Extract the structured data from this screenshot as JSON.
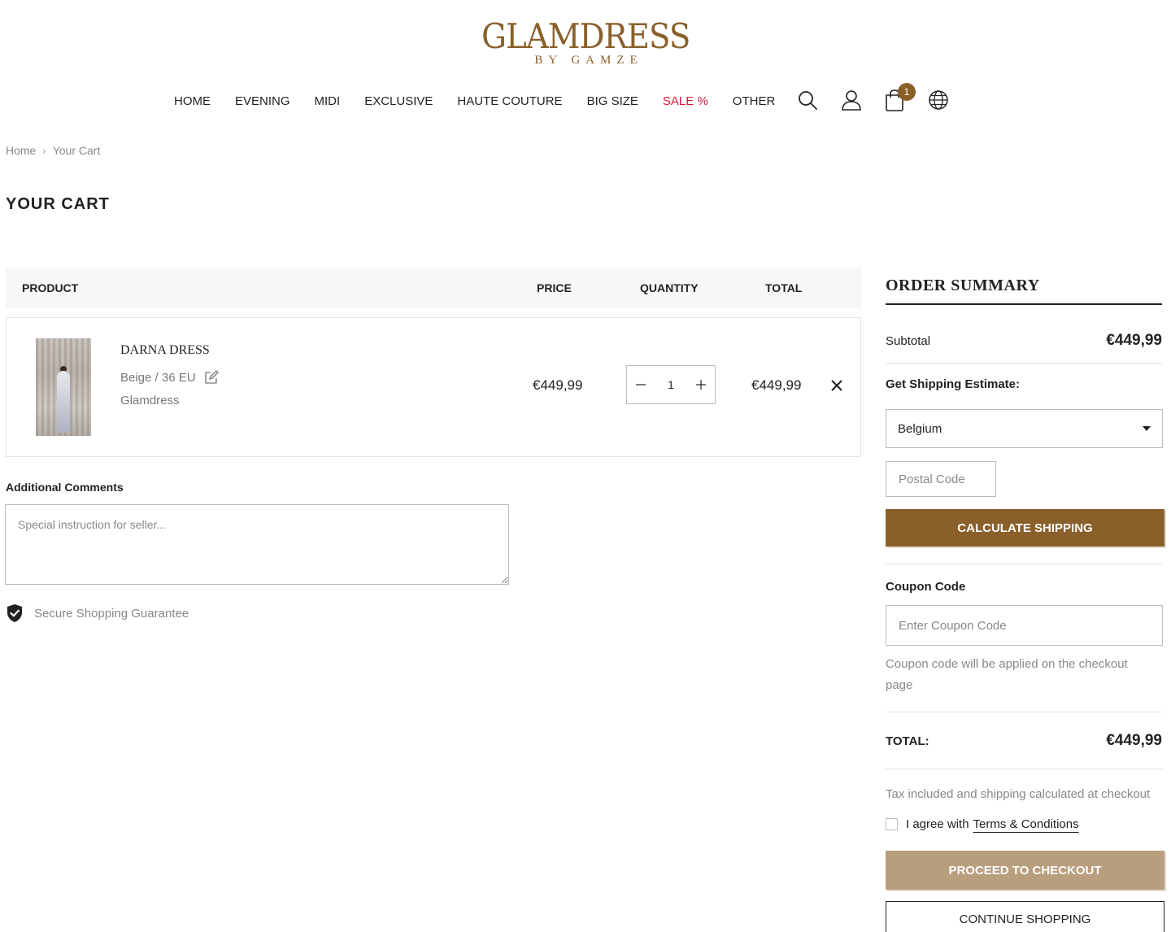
{
  "header": {
    "logo_main": "GLAMDRESS",
    "logo_sub": "BY GAMZE",
    "nav": [
      "HOME",
      "EVENING",
      "MIDI",
      "EXCLUSIVE",
      "HAUTE COUTURE",
      "BIG SIZE",
      "SALE %",
      "OTHER"
    ],
    "cart_count": "1",
    "icons": [
      "search-icon",
      "user-icon",
      "shopping-bag-icon",
      "globe-icon"
    ]
  },
  "breadcrumb": {
    "home": "Home",
    "current": "Your Cart"
  },
  "page_title": "YOUR CART",
  "table": {
    "headers": {
      "product": "PRODUCT",
      "price": "PRICE",
      "quantity": "QUANTITY",
      "total": "TOTAL"
    },
    "item": {
      "name": "DARNA DRESS",
      "variant": "Beige / 36 EU",
      "vendor": "Glamdress",
      "price": "€449,99",
      "quantity": "1",
      "total": "€449,99"
    }
  },
  "comments": {
    "label": "Additional Comments",
    "placeholder": "Special instruction for seller..."
  },
  "secure_text": "Secure Shopping Guarantee",
  "summary": {
    "title": "ORDER SUMMARY",
    "subtotal_label": "Subtotal",
    "subtotal_value": "€449,99",
    "shipping_label": "Get Shipping Estimate:",
    "country": "Belgium",
    "postal_placeholder": "Postal Code",
    "calc_button": "CALCULATE SHIPPING",
    "coupon_label": "Coupon Code",
    "coupon_placeholder": "Enter Coupon Code",
    "coupon_note": "Coupon code will be applied on the checkout page",
    "total_label": "TOTAL:",
    "total_value": "€449,99",
    "tax_note": "Tax included and shipping calculated at checkout",
    "agree_text": "I agree with",
    "terms_link": "Terms & Conditions",
    "checkout_button": "PROCEED TO CHECKOUT",
    "continue_button": "CONTINUE SHOPPING"
  },
  "colors": {
    "brand": "#8a5f2a",
    "checkout_disabled": "#b89e7d",
    "sale": "#d2183a"
  }
}
